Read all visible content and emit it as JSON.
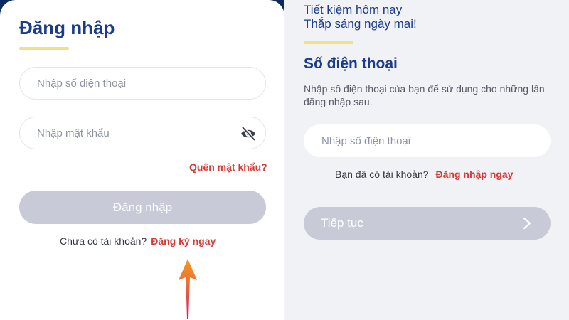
{
  "login": {
    "title": "Đăng nhập",
    "phone_placeholder": "Nhập số điện thoại",
    "password_placeholder": "Nhập mật khẩu",
    "forgot_password": "Quên mật khẩu?",
    "login_button": "Đăng nhập",
    "no_account_text": "Chưa có tài khoản?",
    "register_link": "Đăng ký ngay"
  },
  "phone_step": {
    "tagline_line1": "Tiết kiệm hôm nay",
    "tagline_line2": "Thắp sáng ngày mai!",
    "title": "Số điện thoại",
    "description": "Nhập số điện thoại của bạn để sử dụng cho những lần đăng nhập sau.",
    "phone_placeholder": "Nhập số điện thoại",
    "have_account_text": "Bạn đã có tài khoản?",
    "login_link": "Đăng nhập ngay",
    "continue_button": "Tiếp tục"
  },
  "colors": {
    "brand_blue": "#1b3c88",
    "accent_yellow": "#f2df86",
    "link_red": "#d53a34",
    "disabled_button": "#c8cad8",
    "arrow_orange": "#f59a1c",
    "arrow_pink": "#d1206a"
  },
  "icons": {
    "password_toggle": "eye-slash-icon",
    "continue_chevron": "chevron-right-icon",
    "annotation": "arrow-up-icon"
  }
}
